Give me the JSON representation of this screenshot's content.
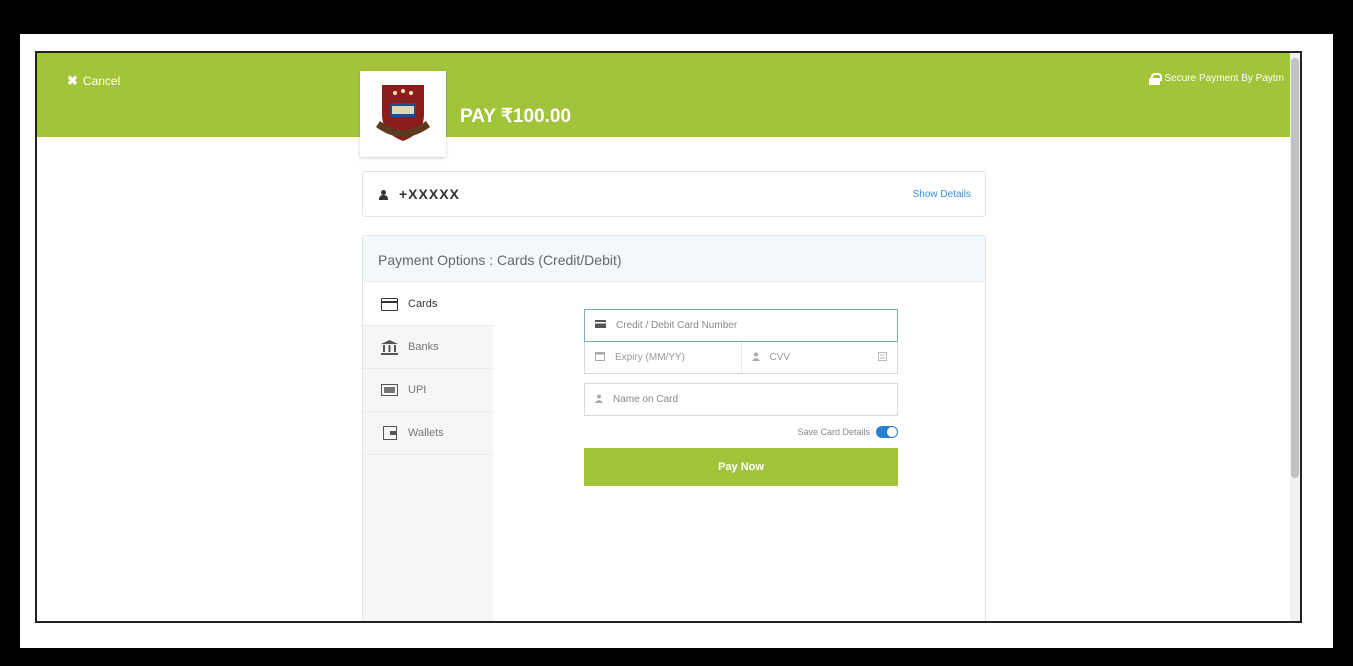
{
  "header": {
    "cancel_label": "Cancel",
    "secure_label": "Secure Payment By Paytm",
    "pay_amount": "PAY ₹100.00"
  },
  "user": {
    "id_masked": "+XXXXX",
    "show_details": "Show Details"
  },
  "payment_options": {
    "title": "Payment Options : Cards (Credit/Debit)",
    "tabs": [
      {
        "label": "Cards",
        "icon": "credit-card-icon",
        "active": true
      },
      {
        "label": "Banks",
        "icon": "bank-icon",
        "active": false
      },
      {
        "label": "UPI",
        "icon": "upi-icon",
        "active": false
      },
      {
        "label": "Wallets",
        "icon": "wallet-icon",
        "active": false
      }
    ]
  },
  "form": {
    "card_number_placeholder": "Credit / Debit Card Number",
    "expiry_placeholder": "Expiry (MM/YY)",
    "cvv_placeholder": "CVV",
    "name_placeholder": "Name on Card",
    "save_card_label": "Save Card Details",
    "pay_button": "Pay Now"
  },
  "colors": {
    "brand_green": "#a1c43a",
    "link_blue": "#3a8fd8"
  }
}
